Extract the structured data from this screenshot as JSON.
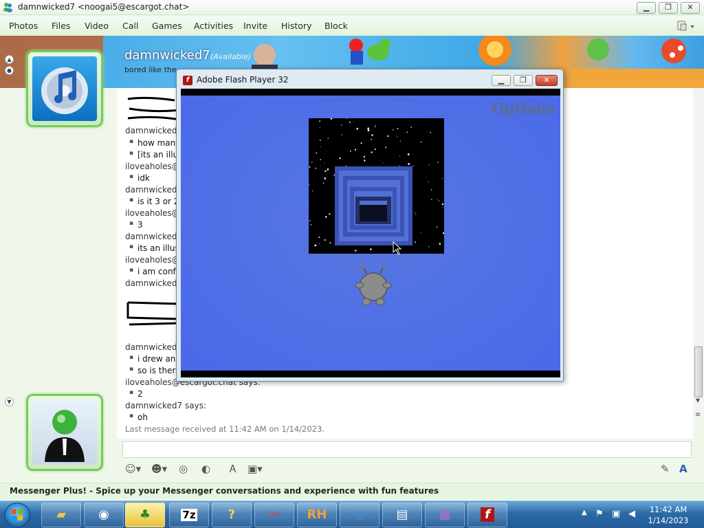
{
  "window": {
    "title": "damnwicked7 <noogai5@escargot.chat>",
    "min_label": "▁",
    "restore_label": "❐",
    "close_label": "✕"
  },
  "menu": [
    "Photos",
    "Files",
    "Video",
    "Call",
    "Games",
    "Activities",
    "Invite",
    "History",
    "Block"
  ],
  "contact": {
    "name": "damnwicked7",
    "status": "(Available)",
    "personal_message": "bored like the"
  },
  "messages": [
    {
      "kind": "says",
      "text": "damnwicked"
    },
    {
      "kind": "msg",
      "text": "how many"
    },
    {
      "kind": "msg",
      "text": "[its an illu"
    },
    {
      "kind": "says",
      "text": "iloveaholes@"
    },
    {
      "kind": "msg",
      "text": "idk"
    },
    {
      "kind": "says",
      "text": "damnwicked"
    },
    {
      "kind": "msg",
      "text": "is it 3 or 2"
    },
    {
      "kind": "says",
      "text": "iloveaholes@"
    },
    {
      "kind": "msg",
      "text": "3"
    },
    {
      "kind": "says",
      "text": "damnwicked"
    },
    {
      "kind": "msg",
      "text": "its an illus"
    },
    {
      "kind": "says",
      "text": "iloveaholes@"
    },
    {
      "kind": "msg",
      "text": "i am conf"
    },
    {
      "kind": "says",
      "text": "damnwicked"
    },
    {
      "kind": "says",
      "text": "damnwicked"
    },
    {
      "kind": "msg",
      "text": "i drew an"
    },
    {
      "kind": "msg",
      "text": "so is ther"
    },
    {
      "kind": "says",
      "text": "iloveaholes@escargot.chat says:"
    },
    {
      "kind": "msg",
      "text": "2"
    },
    {
      "kind": "says",
      "text": "damnwicked7 says:"
    },
    {
      "kind": "msg",
      "text": "oh"
    }
  ],
  "last_message": "Last message received at 11:42 AM on 1/14/2023.",
  "plus_bar": "Messenger Plus! - Spice up your Messenger conversations and experience with fun features",
  "flash": {
    "title": "Adobe Flash Player 32",
    "options_label": "Options"
  },
  "taskbar": {
    "items": [
      "folder-icon",
      "globe-icon",
      "messenger-icon",
      "7z",
      "?",
      "scissors-icon",
      "RH",
      "chrome-icon",
      "computer-icon",
      "winrar-icon",
      "f"
    ],
    "time": "11:42 AM",
    "date": "1/14/2023"
  }
}
